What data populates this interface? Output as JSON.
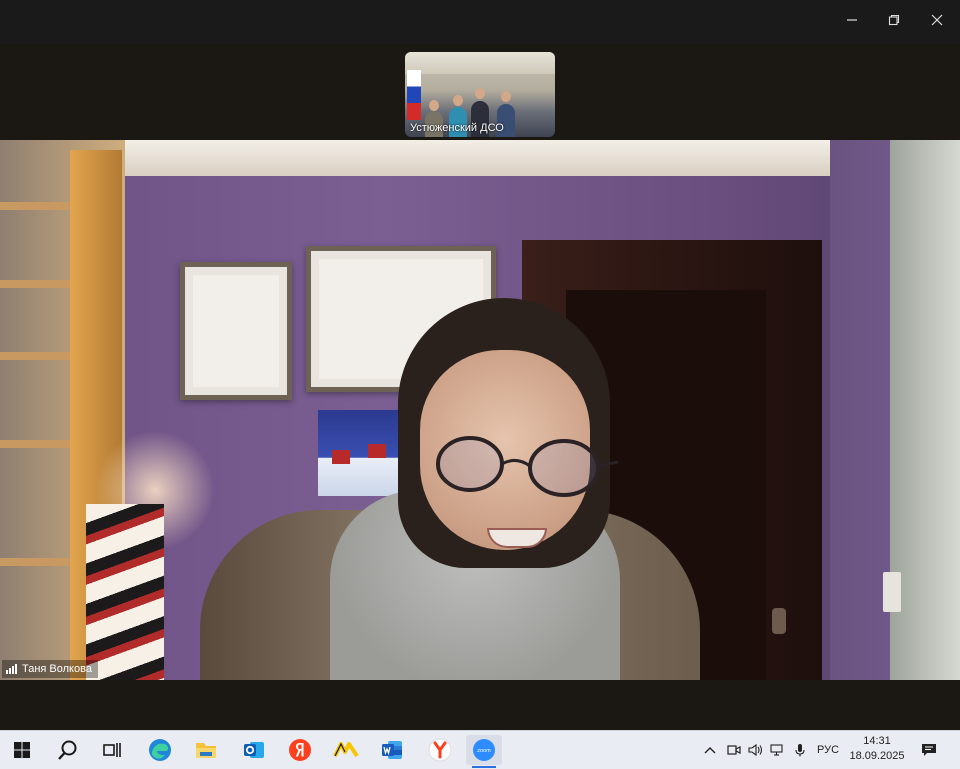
{
  "window": {
    "controls": {
      "minimize_icon": "minimize-icon",
      "restore_icon": "restore-icon",
      "close_icon": "close-icon"
    }
  },
  "participants": {
    "thumbnail_name": "Устюженский ДСО",
    "main_speaker_name": "Таня Волкова"
  },
  "taskbar": {
    "apps": [
      "windows-start",
      "search",
      "task-view",
      "edge",
      "file-explorer",
      "outlook",
      "yandex-browser",
      "yandex-market",
      "word",
      "yandex",
      "zoom"
    ],
    "tray": {
      "language": "РУС",
      "time": "14:31",
      "date": "18.09.2025"
    }
  },
  "colors": {
    "taskbar_bg": "#e9ecf2",
    "active_indicator": "#2f6fdf",
    "zoom_blue": "#2d8cff"
  }
}
